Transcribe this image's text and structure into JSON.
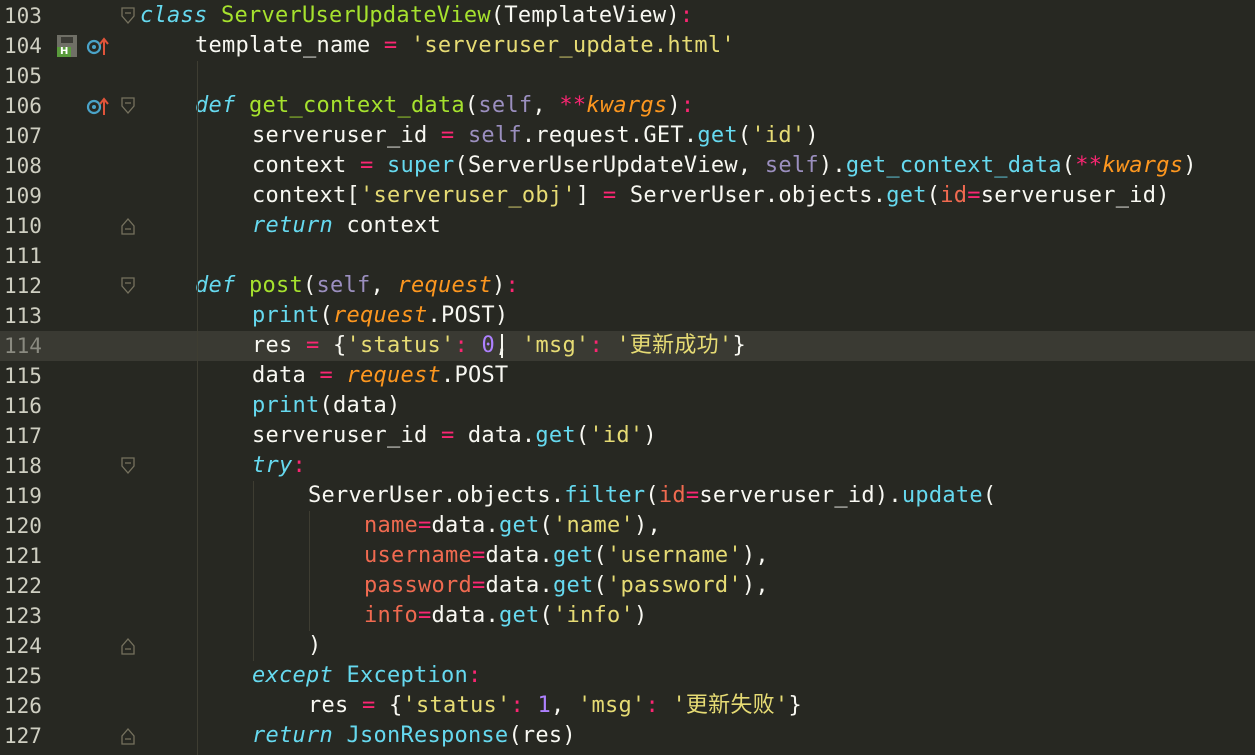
{
  "editor": {
    "current_line": "114",
    "lines": [
      {
        "num": "103"
      },
      {
        "num": "104"
      },
      {
        "num": "105"
      },
      {
        "num": "106"
      },
      {
        "num": "107"
      },
      {
        "num": "108"
      },
      {
        "num": "109"
      },
      {
        "num": "110"
      },
      {
        "num": "111"
      },
      {
        "num": "112"
      },
      {
        "num": "113"
      },
      {
        "num": "114"
      },
      {
        "num": "115"
      },
      {
        "num": "116"
      },
      {
        "num": "117"
      },
      {
        "num": "118"
      },
      {
        "num": "119"
      },
      {
        "num": "120"
      },
      {
        "num": "121"
      },
      {
        "num": "122"
      },
      {
        "num": "123"
      },
      {
        "num": "124"
      },
      {
        "num": "125"
      },
      {
        "num": "126"
      },
      {
        "num": "127"
      }
    ],
    "tokens": {
      "l103": [
        "class",
        " ",
        "ServerUserUpdateView",
        "(",
        "TemplateView",
        ")",
        ":"
      ],
      "l104": [
        "template_name",
        " = ",
        "'serveruser_update.html'"
      ],
      "l106": [
        "def",
        " ",
        "get_context_data",
        "(",
        "self",
        ", ",
        "**",
        "kwargs",
        ")",
        ":"
      ],
      "l107": [
        "serveruser_id",
        " = ",
        "self",
        ".request.GET.",
        "get",
        "(",
        "'id'",
        ")"
      ],
      "l108": [
        "context",
        " = ",
        "super",
        "(ServerUserUpdateView, ",
        "self",
        ").",
        "get_context_data",
        "(",
        "**",
        "kwargs",
        ")"
      ],
      "l109": [
        "context[",
        "'serveruser_obj'",
        "] ",
        "=",
        " ServerUser.objects.",
        "get",
        "(",
        "id",
        "=",
        "serveruser_id)"
      ],
      "l110": [
        "return",
        " context"
      ],
      "l112": [
        "def",
        " ",
        "post",
        "(",
        "self",
        ", ",
        "request",
        ")",
        ":"
      ],
      "l113": [
        "print",
        "(",
        "request",
        ".POST)"
      ],
      "l114": [
        "res ",
        "=",
        " {",
        "'status'",
        ": ",
        "0",
        ", ",
        "'msg'",
        ": ",
        "'更新成功'",
        "}"
      ],
      "l115": [
        "data ",
        "=",
        " ",
        "request",
        ".POST"
      ],
      "l116": [
        "print",
        "(data)"
      ],
      "l117": [
        "serveruser_id ",
        "=",
        " data.",
        "get",
        "(",
        "'id'",
        ")"
      ],
      "l118": [
        "try",
        ":"
      ],
      "l119": [
        "ServerUser.objects.",
        "filter",
        "(",
        "id",
        "=",
        "serveruser_id).",
        "update",
        "("
      ],
      "l120": [
        "name",
        "=",
        "data.",
        "get",
        "(",
        "'name'",
        "),"
      ],
      "l121": [
        "username",
        "=",
        "data.",
        "get",
        "(",
        "'username'",
        "),"
      ],
      "l122": [
        "password",
        "=",
        "data.",
        "get",
        "(",
        "'password'",
        "),"
      ],
      "l123": [
        "info",
        "=",
        "data.",
        "get",
        "(",
        "'info'",
        ")"
      ],
      "l124": [
        ")"
      ],
      "l125": [
        "except",
        " ",
        "Exception",
        ":"
      ],
      "l126": [
        "res ",
        "=",
        " {",
        "'status'",
        ": ",
        "1",
        ", ",
        "'msg'",
        ": ",
        "'更新失败'",
        "}"
      ],
      "l127": [
        "return",
        " ",
        "JsonResponse",
        "(res)"
      ]
    },
    "gutter_badge_label": "H",
    "colors": {
      "background": "#272822",
      "keyword": "#66d9ef",
      "string": "#e6db74",
      "function": "#a6e22e",
      "operator": "#f92672",
      "parameter": "#fd971f",
      "number": "#ae81ff"
    }
  }
}
